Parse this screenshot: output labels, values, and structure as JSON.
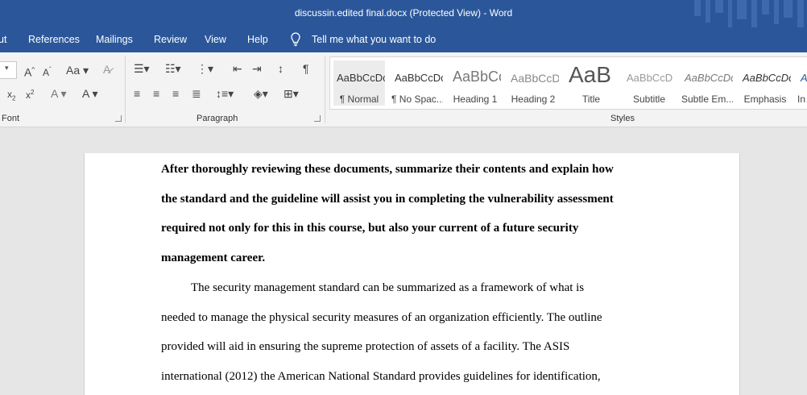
{
  "window": {
    "title": "discussin.edited final.docx (Protected View)  -  Word"
  },
  "tabs": [
    {
      "label": "ut"
    },
    {
      "label": "References"
    },
    {
      "label": "Mailings"
    },
    {
      "label": "Review"
    },
    {
      "label": "View"
    },
    {
      "label": "Help"
    }
  ],
  "tell_me": {
    "label": "Tell me what you want to do"
  },
  "ribbon": {
    "font_group": "Font",
    "paragraph_group": "Paragraph",
    "styles_group": "Styles"
  },
  "styles": [
    {
      "preview": "AaBbCcDc",
      "name": "¶ Normal"
    },
    {
      "preview": "AaBbCcDc",
      "name": "¶ No Spac..."
    },
    {
      "preview": "AaBbCc",
      "name": "Heading 1"
    },
    {
      "preview": "AaBbCcD",
      "name": "Heading 2"
    },
    {
      "preview": "AaB",
      "name": "Title"
    },
    {
      "preview": "AaBbCcD",
      "name": "Subtitle"
    },
    {
      "preview": "AaBbCcDc",
      "name": "Subtle Em..."
    },
    {
      "preview": "AaBbCcDc",
      "name": "Emphasis"
    },
    {
      "preview": "A",
      "name": "In"
    }
  ],
  "document": {
    "lines": [
      "After thoroughly reviewing these documents, summarize their contents and explain how",
      "the standard and the guideline will assist you in completing the vulnerability assessment",
      "required not only for this in this course, but also your current of a future security",
      "management career.",
      "The security management standard can be summarized as a framework of what is",
      "needed to manage the physical security measures of an organization efficiently. The outline",
      "provided will aid in ensuring the supreme protection of assets of a facility. The ASIS",
      "international (2012) the American National Standard provides guidelines for identification,"
    ]
  }
}
